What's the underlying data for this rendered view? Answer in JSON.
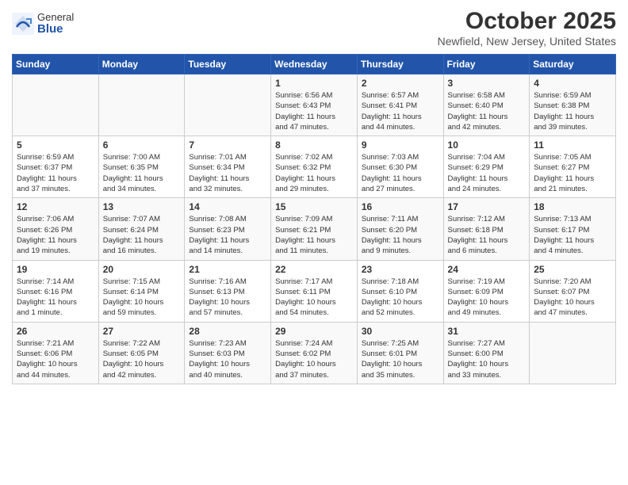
{
  "header": {
    "logo_general": "General",
    "logo_blue": "Blue",
    "title": "October 2025",
    "subtitle": "Newfield, New Jersey, United States"
  },
  "days_of_week": [
    "Sunday",
    "Monday",
    "Tuesday",
    "Wednesday",
    "Thursday",
    "Friday",
    "Saturday"
  ],
  "weeks": [
    [
      {
        "day": "",
        "info": ""
      },
      {
        "day": "",
        "info": ""
      },
      {
        "day": "",
        "info": ""
      },
      {
        "day": "1",
        "info": "Sunrise: 6:56 AM\nSunset: 6:43 PM\nDaylight: 11 hours\nand 47 minutes."
      },
      {
        "day": "2",
        "info": "Sunrise: 6:57 AM\nSunset: 6:41 PM\nDaylight: 11 hours\nand 44 minutes."
      },
      {
        "day": "3",
        "info": "Sunrise: 6:58 AM\nSunset: 6:40 PM\nDaylight: 11 hours\nand 42 minutes."
      },
      {
        "day": "4",
        "info": "Sunrise: 6:59 AM\nSunset: 6:38 PM\nDaylight: 11 hours\nand 39 minutes."
      }
    ],
    [
      {
        "day": "5",
        "info": "Sunrise: 6:59 AM\nSunset: 6:37 PM\nDaylight: 11 hours\nand 37 minutes."
      },
      {
        "day": "6",
        "info": "Sunrise: 7:00 AM\nSunset: 6:35 PM\nDaylight: 11 hours\nand 34 minutes."
      },
      {
        "day": "7",
        "info": "Sunrise: 7:01 AM\nSunset: 6:34 PM\nDaylight: 11 hours\nand 32 minutes."
      },
      {
        "day": "8",
        "info": "Sunrise: 7:02 AM\nSunset: 6:32 PM\nDaylight: 11 hours\nand 29 minutes."
      },
      {
        "day": "9",
        "info": "Sunrise: 7:03 AM\nSunset: 6:30 PM\nDaylight: 11 hours\nand 27 minutes."
      },
      {
        "day": "10",
        "info": "Sunrise: 7:04 AM\nSunset: 6:29 PM\nDaylight: 11 hours\nand 24 minutes."
      },
      {
        "day": "11",
        "info": "Sunrise: 7:05 AM\nSunset: 6:27 PM\nDaylight: 11 hours\nand 21 minutes."
      }
    ],
    [
      {
        "day": "12",
        "info": "Sunrise: 7:06 AM\nSunset: 6:26 PM\nDaylight: 11 hours\nand 19 minutes."
      },
      {
        "day": "13",
        "info": "Sunrise: 7:07 AM\nSunset: 6:24 PM\nDaylight: 11 hours\nand 16 minutes."
      },
      {
        "day": "14",
        "info": "Sunrise: 7:08 AM\nSunset: 6:23 PM\nDaylight: 11 hours\nand 14 minutes."
      },
      {
        "day": "15",
        "info": "Sunrise: 7:09 AM\nSunset: 6:21 PM\nDaylight: 11 hours\nand 11 minutes."
      },
      {
        "day": "16",
        "info": "Sunrise: 7:11 AM\nSunset: 6:20 PM\nDaylight: 11 hours\nand 9 minutes."
      },
      {
        "day": "17",
        "info": "Sunrise: 7:12 AM\nSunset: 6:18 PM\nDaylight: 11 hours\nand 6 minutes."
      },
      {
        "day": "18",
        "info": "Sunrise: 7:13 AM\nSunset: 6:17 PM\nDaylight: 11 hours\nand 4 minutes."
      }
    ],
    [
      {
        "day": "19",
        "info": "Sunrise: 7:14 AM\nSunset: 6:16 PM\nDaylight: 11 hours\nand 1 minute."
      },
      {
        "day": "20",
        "info": "Sunrise: 7:15 AM\nSunset: 6:14 PM\nDaylight: 10 hours\nand 59 minutes."
      },
      {
        "day": "21",
        "info": "Sunrise: 7:16 AM\nSunset: 6:13 PM\nDaylight: 10 hours\nand 57 minutes."
      },
      {
        "day": "22",
        "info": "Sunrise: 7:17 AM\nSunset: 6:11 PM\nDaylight: 10 hours\nand 54 minutes."
      },
      {
        "day": "23",
        "info": "Sunrise: 7:18 AM\nSunset: 6:10 PM\nDaylight: 10 hours\nand 52 minutes."
      },
      {
        "day": "24",
        "info": "Sunrise: 7:19 AM\nSunset: 6:09 PM\nDaylight: 10 hours\nand 49 minutes."
      },
      {
        "day": "25",
        "info": "Sunrise: 7:20 AM\nSunset: 6:07 PM\nDaylight: 10 hours\nand 47 minutes."
      }
    ],
    [
      {
        "day": "26",
        "info": "Sunrise: 7:21 AM\nSunset: 6:06 PM\nDaylight: 10 hours\nand 44 minutes."
      },
      {
        "day": "27",
        "info": "Sunrise: 7:22 AM\nSunset: 6:05 PM\nDaylight: 10 hours\nand 42 minutes."
      },
      {
        "day": "28",
        "info": "Sunrise: 7:23 AM\nSunset: 6:03 PM\nDaylight: 10 hours\nand 40 minutes."
      },
      {
        "day": "29",
        "info": "Sunrise: 7:24 AM\nSunset: 6:02 PM\nDaylight: 10 hours\nand 37 minutes."
      },
      {
        "day": "30",
        "info": "Sunrise: 7:25 AM\nSunset: 6:01 PM\nDaylight: 10 hours\nand 35 minutes."
      },
      {
        "day": "31",
        "info": "Sunrise: 7:27 AM\nSunset: 6:00 PM\nDaylight: 10 hours\nand 33 minutes."
      },
      {
        "day": "",
        "info": ""
      }
    ]
  ]
}
